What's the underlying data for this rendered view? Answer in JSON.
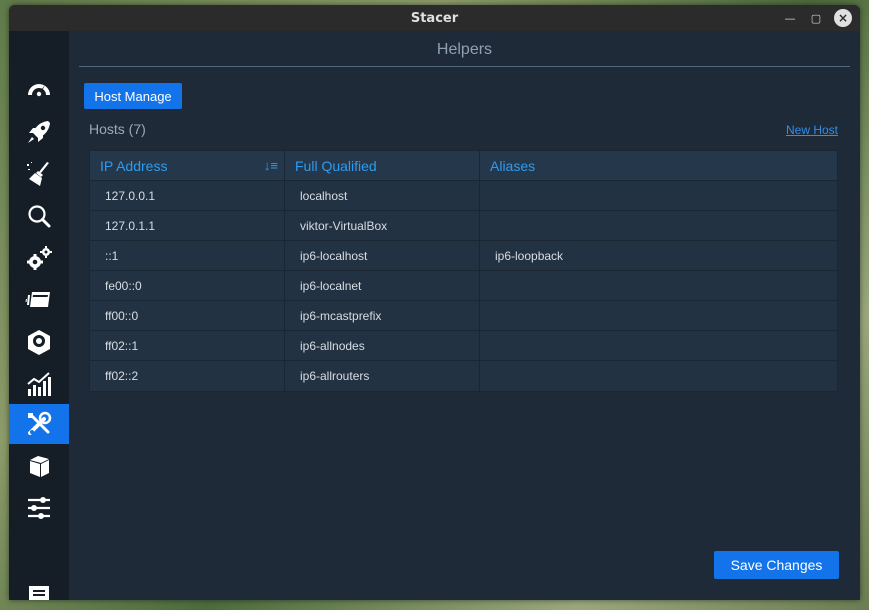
{
  "window": {
    "title": "Stacer"
  },
  "header": {
    "title": "Helpers"
  },
  "tabs": [
    {
      "label": "Host Manage"
    }
  ],
  "hosts": {
    "label": "Hosts (7)",
    "new_host_label": "New Host",
    "columns": [
      "IP Address",
      "Full Qualified",
      "Aliases"
    ],
    "rows": [
      [
        "127.0.0.1",
        "localhost",
        ""
      ],
      [
        "127.0.1.1",
        "viktor-VirtualBox",
        ""
      ],
      [
        "::1",
        "ip6-localhost",
        "ip6-loopback"
      ],
      [
        "fe00::0",
        "ip6-localnet",
        ""
      ],
      [
        "ff00::0",
        "ip6-mcastprefix",
        ""
      ],
      [
        "ff02::1",
        "ip6-allnodes",
        ""
      ],
      [
        "ff02::2",
        "ip6-allrouters",
        ""
      ]
    ]
  },
  "footer": {
    "save_label": "Save Changes"
  },
  "sidebar": {
    "items": [
      {
        "icon": "dashboard-icon"
      },
      {
        "icon": "rocket-icon"
      },
      {
        "icon": "broom-icon"
      },
      {
        "icon": "search-icon"
      },
      {
        "icon": "gears-icon"
      },
      {
        "icon": "processes-icon"
      },
      {
        "icon": "uninstaller-icon"
      },
      {
        "icon": "resources-chart-icon"
      },
      {
        "icon": "tools-icon",
        "active": true
      },
      {
        "icon": "package-icon"
      },
      {
        "icon": "sliders-icon"
      },
      {
        "icon": "feedback-icon"
      }
    ]
  },
  "colors": {
    "accent": "#1273eb",
    "bg": "#1e2a38",
    "sidebar": "#151d27",
    "header_text": "#2d9bf0"
  }
}
